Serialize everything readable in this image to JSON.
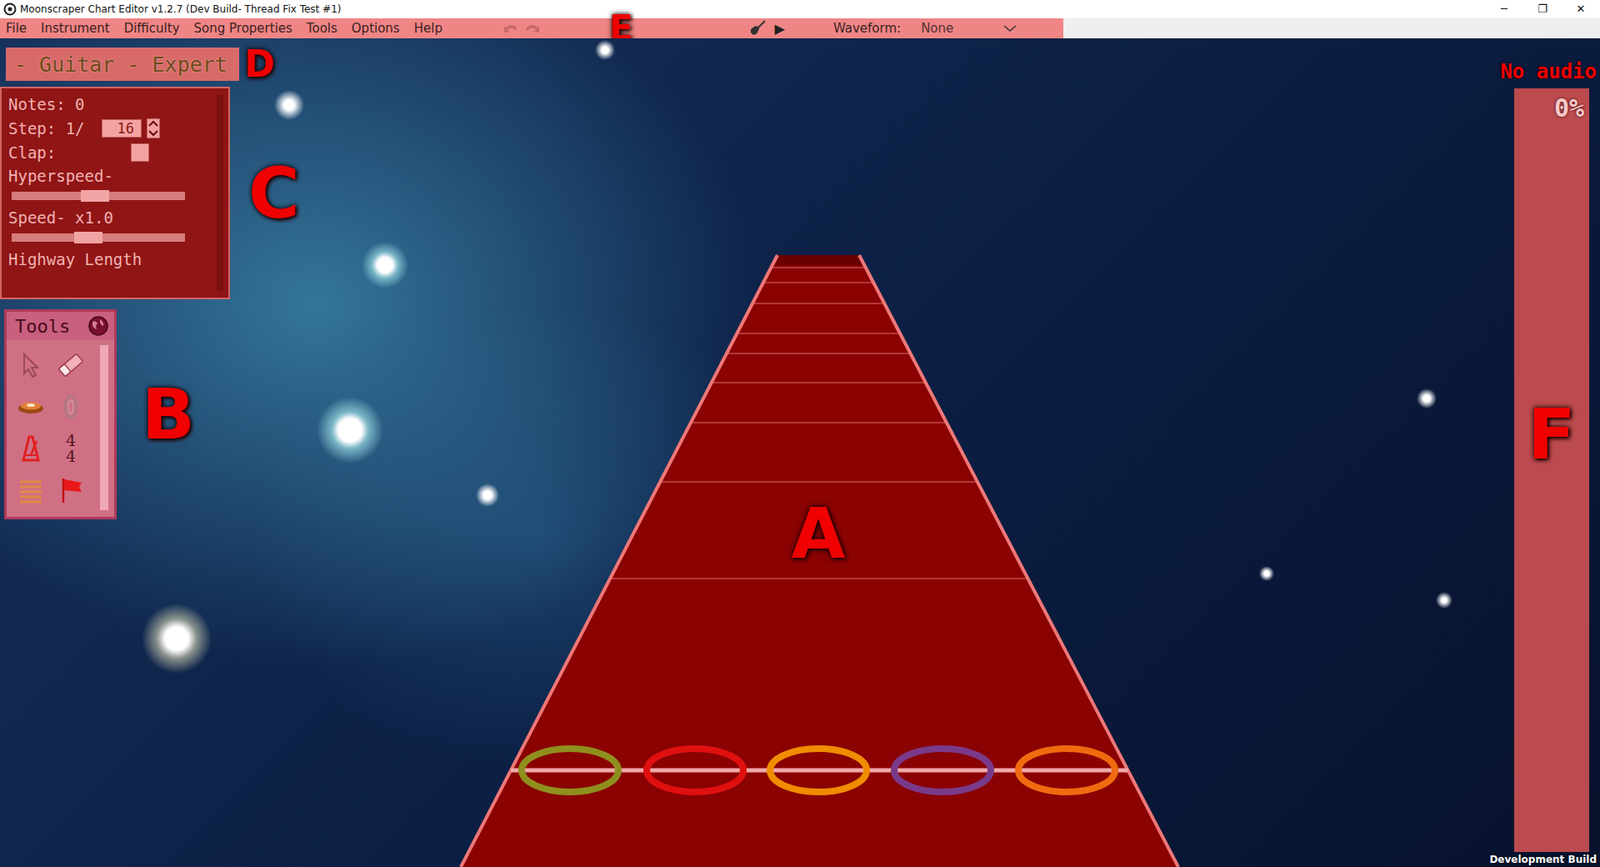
{
  "window": {
    "title": "Moonscraper Chart Editor v1.2.7 (Dev Build- Thread Fix Test #1)",
    "controls": [
      "─",
      "❐",
      "✕"
    ]
  },
  "menu_bar": {
    "marker": "E",
    "items": [
      "File",
      "Instrument",
      "Difficulty",
      "Song Properties",
      "Tools",
      "Options",
      "Help"
    ],
    "undo": {
      "disabled": true
    },
    "redo": {
      "disabled": true
    },
    "play": "▶",
    "waveform": {
      "label": "Waveform:",
      "value": "None"
    }
  },
  "chart_label": {
    "text": "- Guitar - Expert",
    "marker": "D"
  },
  "properties": {
    "marker": "C",
    "notes": "Notes: 0",
    "step_label": "Step: 1/",
    "step_value": "16",
    "clap_label": "Clap:",
    "clap_checked": false,
    "hyperspeed": {
      "label": "Hyperspeed-",
      "level": 0.48
    },
    "speed": {
      "label": "Speed- x1.0",
      "level": 0.44
    },
    "highway_length": "Highway Length"
  },
  "tools": {
    "title": "Tools",
    "marker": "B",
    "items": [
      {
        "kind": "cursor",
        "selected": false
      },
      {
        "kind": "eraser",
        "selected": false
      },
      {
        "kind": "note",
        "selected": false
      },
      {
        "kind": "starpower",
        "selected": false
      },
      {
        "kind": "bpm",
        "selected": false
      },
      {
        "kind": "timesig",
        "selected": false,
        "numerator": "4",
        "denominator": "4"
      },
      {
        "kind": "section",
        "selected": false
      },
      {
        "kind": "event",
        "selected": false
      }
    ]
  },
  "highway": {
    "marker": "A",
    "strikers": [
      {
        "color": "#8f8f1e"
      },
      {
        "color": "#e01010"
      },
      {
        "color": "#f08c00"
      },
      {
        "color": "#7a3a8a"
      },
      {
        "color": "#f06a10"
      }
    ]
  },
  "audio": {
    "status": "No audio",
    "progress": "0%",
    "level": 0,
    "marker": "F"
  },
  "build_label": "Development Build"
}
